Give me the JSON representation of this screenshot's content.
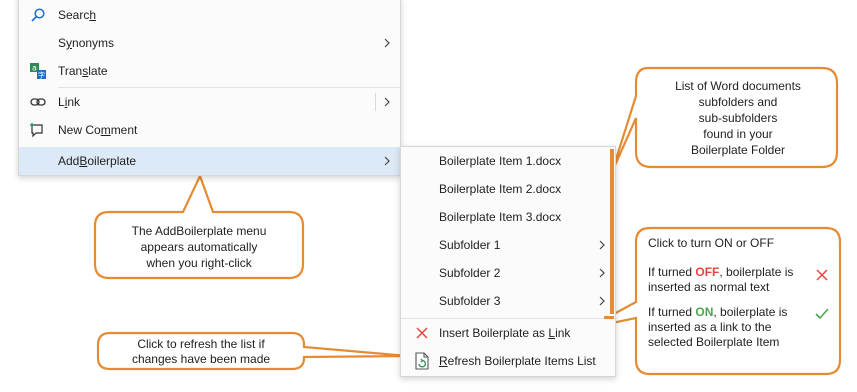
{
  "main_menu": {
    "items": [
      {
        "pre": "Searc",
        "u": "h",
        "post": "",
        "icon": "search-icon"
      },
      {
        "pre": "S",
        "u": "y",
        "post": "nonyms",
        "icon": ""
      },
      {
        "pre": "Tran",
        "u": "s",
        "post": "late",
        "icon": "translate-icon"
      },
      {
        "pre": "L",
        "u": "i",
        "post": "nk",
        "icon": "link-icon"
      },
      {
        "pre": "New Co",
        "u": "m",
        "post": "ment",
        "icon": "new-comment-icon"
      },
      {
        "pre": "Add",
        "u": "B",
        "post": "oilerplate",
        "icon": ""
      }
    ]
  },
  "sub_menu": {
    "items": [
      {
        "label": "Boilerplate Item 1.docx"
      },
      {
        "label": "Boilerplate Item 2.docx"
      },
      {
        "label": "Boilerplate Item 3.docx"
      },
      {
        "label": "Subfolder 1"
      },
      {
        "label": "Subfolder 2"
      },
      {
        "label": "Subfolder 3"
      }
    ],
    "insert": {
      "pre": "Insert Boilerplate as ",
      "u": "L",
      "post": "ink"
    },
    "refresh": {
      "pre": "",
      "u": "R",
      "post": "efresh Boilerplate Items List"
    }
  },
  "callouts": {
    "list": [
      "List of Word documents",
      "subfolders and",
      "sub-subfolders",
      "found in your",
      "Boilerplate Folder"
    ],
    "auto": [
      "The AddBoilerplate menu",
      "appears automatically",
      "when you right-click"
    ],
    "refresh": [
      "Click to refresh the list if",
      "changes have been made"
    ],
    "toggle": {
      "title": "Click to turn ON or OFF",
      "off_pre": "If turned ",
      "off_word": "OFF",
      "off_post": ", boilerplate is",
      "off_line2": "inserted as normal text",
      "on_pre": "If turned ",
      "on_word": "ON",
      "on_post": ",  boilerplate is",
      "on_line2": "inserted as a link to the",
      "on_line3": "selected Boilerplate Item"
    }
  },
  "colors": {
    "accent_orange": "#e58b33",
    "off_red": "#e8453c",
    "on_green": "#4aa84a",
    "highlight": "#dce9f7",
    "icon_blue": "#1a6fc9"
  }
}
